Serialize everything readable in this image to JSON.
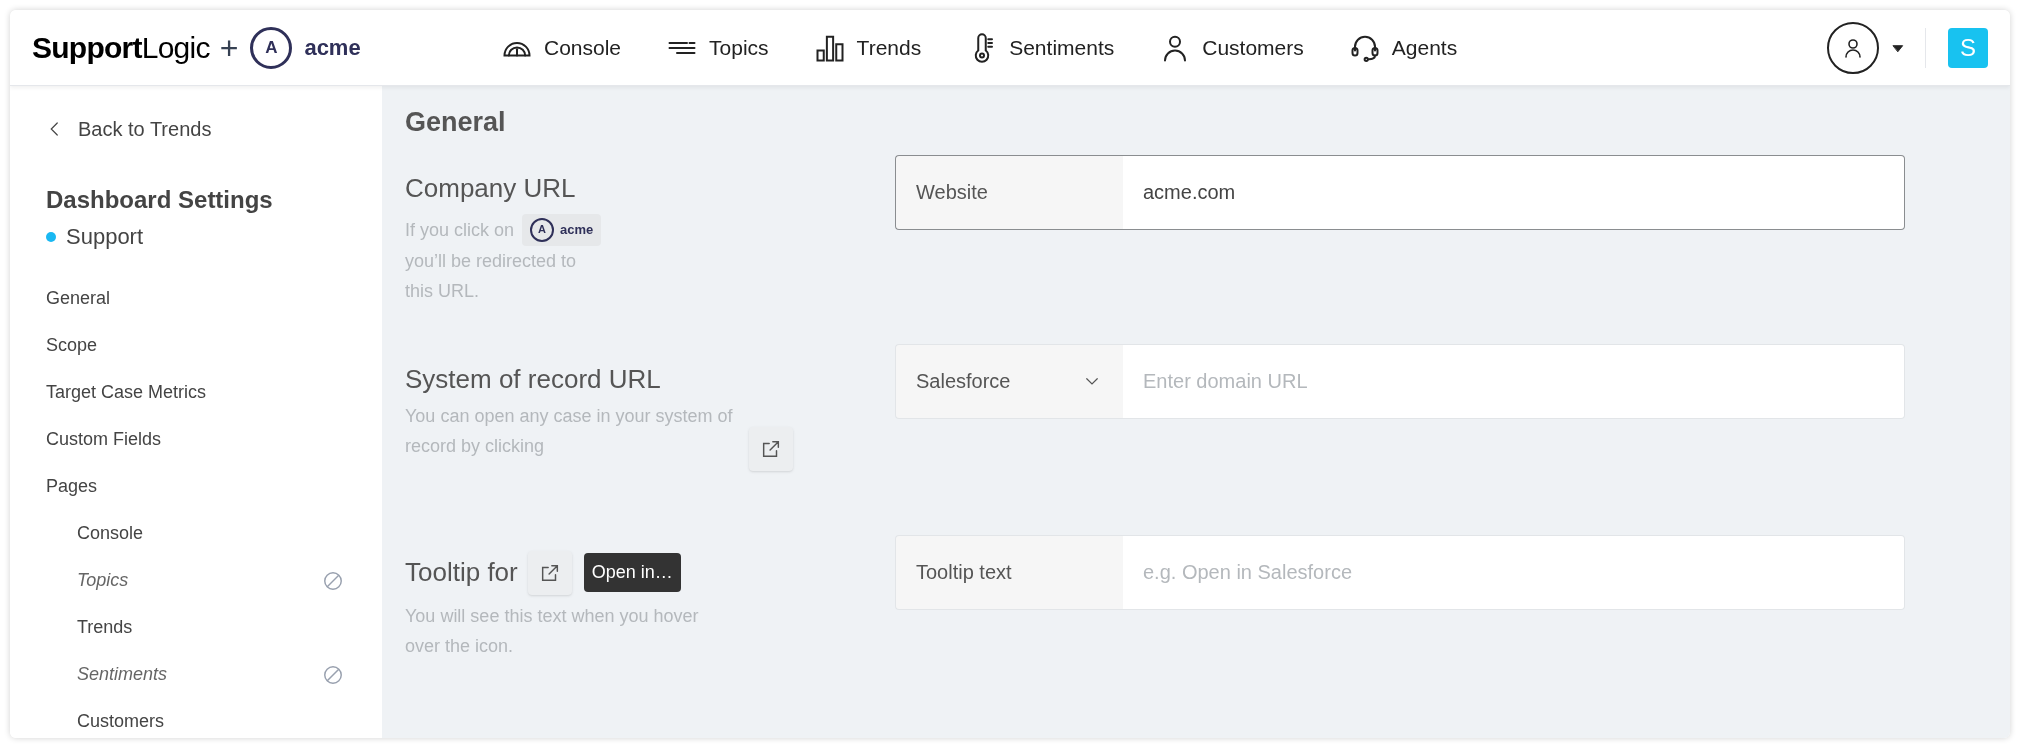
{
  "header": {
    "logo": {
      "brand_bold": "Support",
      "brand_light": "Logic",
      "plus": "+",
      "partner_mark": "A",
      "partner_name": "acme"
    },
    "nav": [
      {
        "kind": "gauge",
        "label": "Console"
      },
      {
        "kind": "lines",
        "label": "Topics"
      },
      {
        "kind": "bars",
        "label": "Trends"
      },
      {
        "kind": "thermometer",
        "label": "Sentiments"
      },
      {
        "kind": "person",
        "label": "Customers"
      },
      {
        "kind": "headset",
        "label": "Agents"
      }
    ],
    "user_badge": "S"
  },
  "sidebar": {
    "back_link": "Back to Trends",
    "title": "Dashboard Settings",
    "dashboard": {
      "name": "Support",
      "color": "#1ab8f2"
    },
    "items": [
      {
        "label": "General",
        "disabled": false
      },
      {
        "label": "Scope",
        "disabled": false
      },
      {
        "label": "Target Case Metrics",
        "disabled": false
      },
      {
        "label": "Custom Fields",
        "disabled": false
      },
      {
        "label": "Pages",
        "disabled": false,
        "children": [
          {
            "label": "Console",
            "disabled": false
          },
          {
            "label": "Topics",
            "disabled": true
          },
          {
            "label": "Trends",
            "disabled": false
          },
          {
            "label": "Sentiments",
            "disabled": true
          },
          {
            "label": "Customers",
            "disabled": false
          }
        ]
      }
    ]
  },
  "main": {
    "heading": "General",
    "settings": [
      {
        "kind": "company",
        "title": "Company URL",
        "description_before": "If you click on",
        "chip_mark": "A",
        "chip_name": "acme",
        "description_after": "you’ll be redirected to this URL.",
        "field": {
          "kind": "addon",
          "label": "Website",
          "value": "acme.com",
          "focused": true
        }
      },
      {
        "kind": "record",
        "title": "System of record URL",
        "description_before": "You can open any case in your system of record by clicking",
        "field": {
          "kind": "select",
          "label": "Salesforce",
          "placeholder": "Enter domain URL",
          "focused": false
        }
      },
      {
        "kind": "tooltip",
        "title": "Tooltip for",
        "tooltip": "Open in…",
        "description_before": "You will see this text when you hover over the icon.",
        "field": {
          "kind": "addon",
          "label": "Tooltip text",
          "placeholder": "e.g. Open in Salesforce",
          "focused": false
        }
      }
    ]
  }
}
